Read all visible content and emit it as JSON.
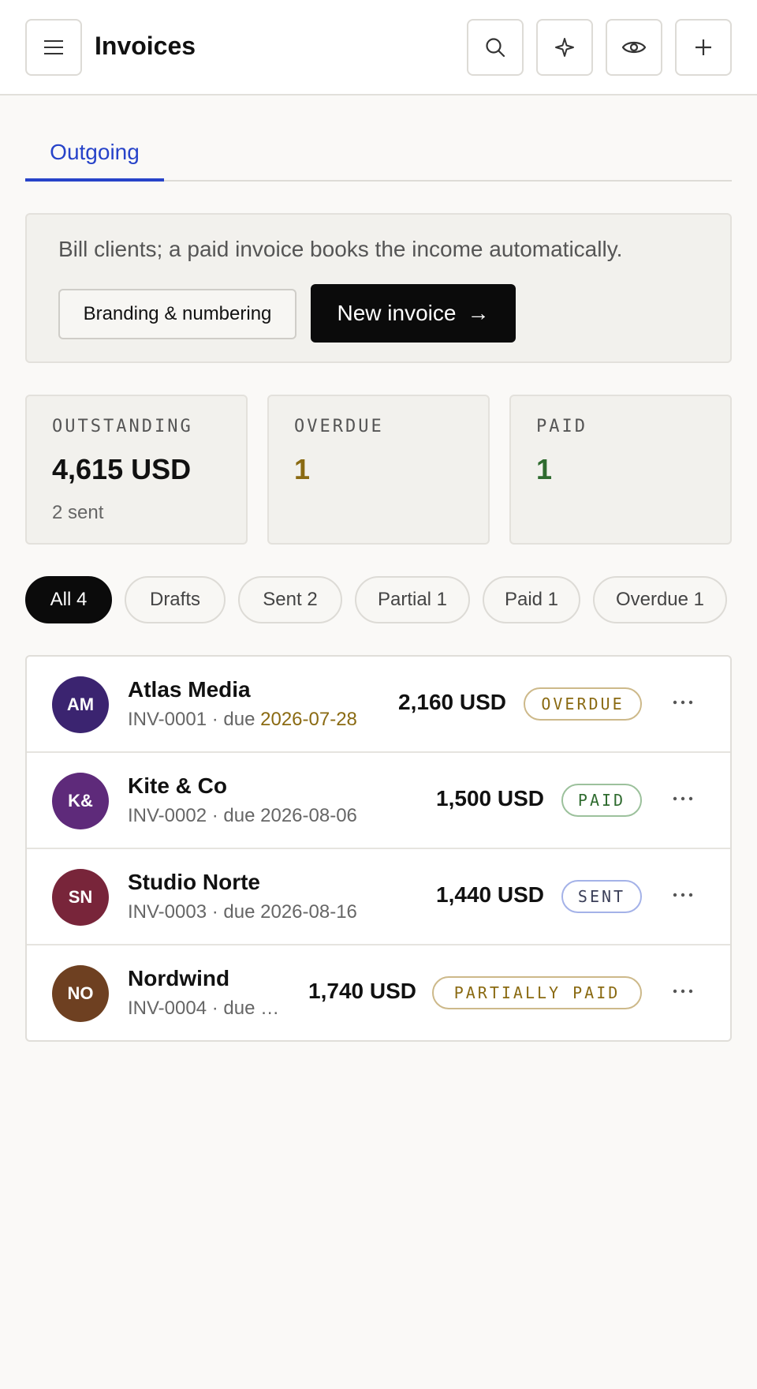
{
  "header": {
    "title": "Invoices",
    "menu_icon": "menu-icon",
    "actions": [
      "search-icon",
      "sparkle-icon",
      "eye-icon",
      "plus-icon"
    ]
  },
  "tabs": [
    {
      "label": "Outgoing",
      "active": true
    }
  ],
  "banner": {
    "text": "Bill clients; a paid invoice books the income automatically.",
    "secondary_button": "Branding & numbering",
    "primary_button": "New invoice",
    "primary_button_arrow": "→"
  },
  "stats": {
    "outstanding": {
      "label": "OUTSTANDING",
      "value": "4,615 USD",
      "sub": "2 sent"
    },
    "overdue": {
      "label": "OVERDUE",
      "value": "1"
    },
    "paid": {
      "label": "PAID",
      "value": "1"
    }
  },
  "filters": [
    {
      "label": "All 4",
      "active": true
    },
    {
      "label": "Drafts",
      "active": false
    },
    {
      "label": "Sent 2",
      "active": false
    },
    {
      "label": "Partial 1",
      "active": false
    },
    {
      "label": "Paid 1",
      "active": false
    },
    {
      "label": "Overdue 1",
      "active": false
    }
  ],
  "invoices": [
    {
      "initials": "AM",
      "client": "Atlas Media",
      "number": "INV-0001",
      "due_prefix": "· due",
      "due": "2026-07-28",
      "amount": "2,160 USD",
      "status": "OVERDUE"
    },
    {
      "initials": "K&",
      "client": "Kite & Co",
      "number": "INV-0002",
      "due_prefix": "· due",
      "due": "2026-08-06",
      "amount": "1,500 USD",
      "status": "PAID"
    },
    {
      "initials": "SN",
      "client": "Studio Norte",
      "number": "INV-0003",
      "due_prefix": "· due",
      "due": "2026-08-16",
      "amount": "1,440 USD",
      "status": "SENT"
    },
    {
      "initials": "NO",
      "client": "Nordwind",
      "number": "INV-0004",
      "due_prefix": "· due …",
      "due": "",
      "amount": "1,740 USD",
      "status": "PARTIALLY PAID"
    }
  ],
  "colors": {
    "accent": "#2743c9",
    "overdue": "#8a6a12",
    "paid": "#2f6b2f",
    "avatar_am": "#3b2470",
    "avatar_kc": "#5e2a7a",
    "avatar_sn": "#78253a",
    "avatar_no": "#6e4021"
  }
}
